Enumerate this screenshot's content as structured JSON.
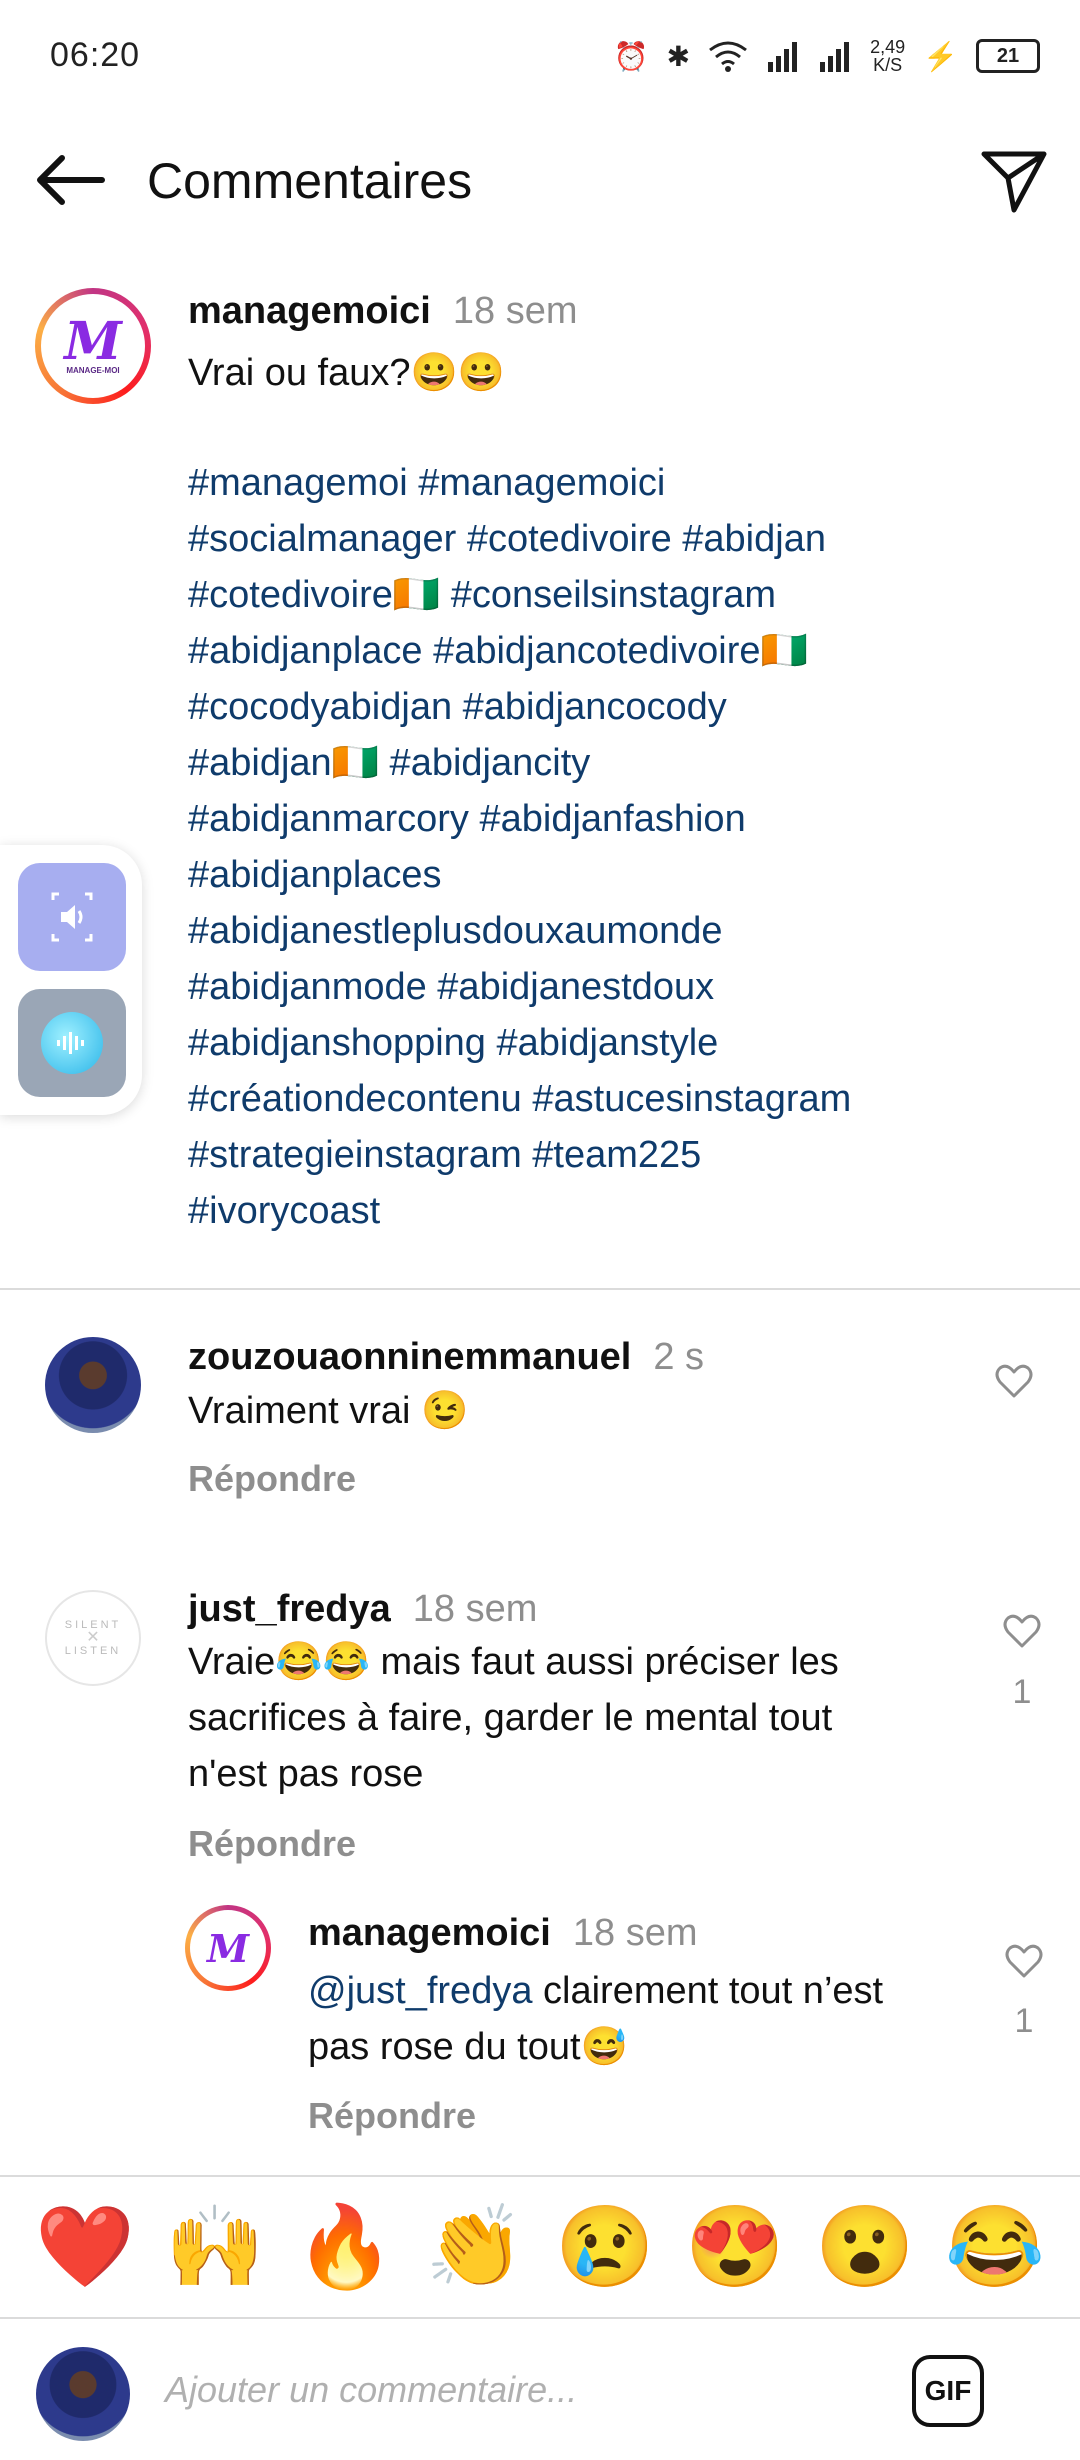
{
  "status_bar": {
    "time": "06:20",
    "net_speed_value": "2,49",
    "net_speed_unit": "K/S",
    "battery": "21"
  },
  "header": {
    "title": "Commentaires"
  },
  "post": {
    "username": "managemoici",
    "time": "18 sem",
    "caption": "Vrai ou faux?😀😀",
    "hashtag_lines": [
      "#managemoi #managemoici",
      "#socialmanager #cotedivoire #abidjan",
      "#cotedivoire🇨🇮 #conseilsinstagram",
      "#abidjanplace #abidjancotedivoire🇨🇮",
      "#cocodyabidjan #abidjancocody",
      "#abidjan🇨🇮 #abidjancity",
      "#abidjanmarcory #abidjanfashion",
      "#abidjanplaces",
      "#abidjanestleplusdouxaumonde",
      "#abidjanmode #abidjanestdoux",
      "#abidjanshopping #abidjanstyle",
      "#créationdecontenu #astucesinstagram",
      "#strategieinstagram #team225",
      "#ivorycoast"
    ]
  },
  "comments": [
    {
      "username": "zouzouaonninemmanuel",
      "time": "2 s",
      "lines": [
        "Vraiment vrai 😉"
      ],
      "reply_label": "Répondre",
      "likes": ""
    },
    {
      "username": "just_fredya",
      "time": "18 sem",
      "lines": [
        "Vraie😂😂 mais faut aussi préciser les",
        "sacrifices à faire, garder le mental tout",
        "n'est pas rose"
      ],
      "reply_label": "Répondre",
      "likes": "1",
      "avatar_text_top": "SILENT",
      "avatar_text_bottom": "LISTEN"
    }
  ],
  "reply": {
    "username": "managemoici",
    "time": "18 sem",
    "mention": "@just_fredya",
    "line1_rest": " clairement tout n’est",
    "line2": "pas rose du tout😅",
    "reply_label": "Répondre",
    "likes": "1"
  },
  "emoji_bar": [
    "❤️",
    "🙌",
    "🔥",
    "👏",
    "😢",
    "😍",
    "😮",
    "😂"
  ],
  "input": {
    "placeholder": "Ajouter un commentaire...",
    "gif_label": "GIF"
  },
  "logo_text": "MANAGE-MOI"
}
